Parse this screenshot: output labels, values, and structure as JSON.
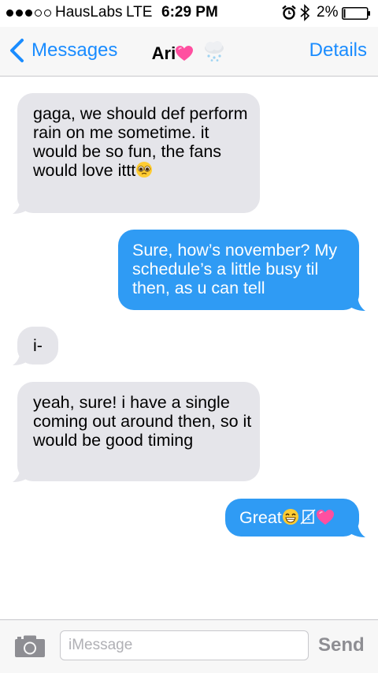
{
  "status_bar": {
    "carrier": "HausLabs",
    "network": "LTE",
    "time": "6:29 PM",
    "battery": "2%",
    "signal_bars_filled": 3,
    "signal_bars_total": 5
  },
  "nav": {
    "back_label": "Messages",
    "contact_name": "Ari",
    "details_label": "Details"
  },
  "messages": [
    {
      "direction": "incoming",
      "text": "gaga, we should def perform rain on me sometime. it would be so fun, the fans would love ittt"
    },
    {
      "direction": "outgoing",
      "text": "Sure, how’s november? My schedule’s a little busy til then, as u can tell"
    },
    {
      "direction": "incoming",
      "text": "i-"
    },
    {
      "direction": "incoming",
      "text": "yeah, sure! i have a single coming out around then, so it would be good timing"
    },
    {
      "direction": "outgoing",
      "text": "Great"
    }
  ],
  "input_bar": {
    "placeholder": "iMessage",
    "send_label": "Send"
  },
  "colors": {
    "accent": "#1a8cff",
    "outgoing_bubble": "#2f9bf4",
    "incoming_bubble": "#e5e5ea"
  },
  "icons": [
    "signal-dots",
    "alarm-icon",
    "bluetooth-icon",
    "battery-icon",
    "back-chevron-icon",
    "heart-emoji",
    "snow-cloud-emoji",
    "pleading-face-emoji",
    "grin-emoji",
    "camera-icon"
  ]
}
